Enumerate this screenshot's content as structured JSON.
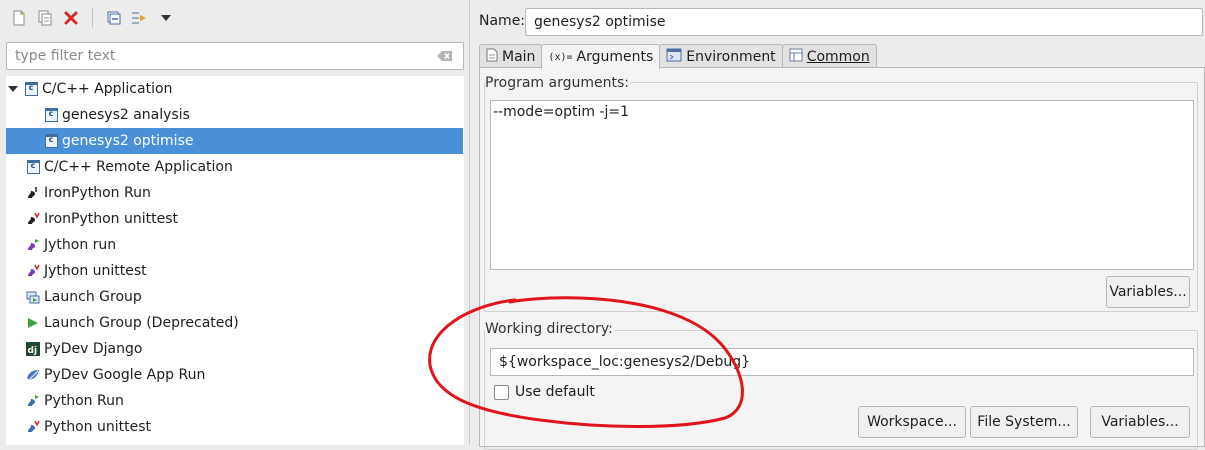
{
  "toolbar": {
    "icons": [
      "new-config-icon",
      "duplicate-icon",
      "delete-icon",
      "collapse-all-icon",
      "filter-icon",
      "view-menu-icon"
    ],
    "delete_color": "#d42a2a"
  },
  "filter": {
    "placeholder": "type filter text"
  },
  "tree": {
    "items": [
      {
        "label": "C/C++ Application",
        "icon": "cpp-app-icon",
        "expanded": true
      },
      {
        "label": "genesys2 analysis",
        "icon": "cpp-config-icon"
      },
      {
        "label": "genesys2 optimise",
        "icon": "cpp-config-icon",
        "selected": true
      },
      {
        "label": "C/C++ Remote Application",
        "icon": "cpp-app-icon"
      },
      {
        "label": "IronPython Run",
        "icon": "ironpython-run-icon"
      },
      {
        "label": "IronPython unittest",
        "icon": "ironpython-unittest-icon"
      },
      {
        "label": "Jython run",
        "icon": "jython-run-icon"
      },
      {
        "label": "Jython unittest",
        "icon": "jython-unittest-icon"
      },
      {
        "label": "Launch Group",
        "icon": "launch-group-icon"
      },
      {
        "label": "Launch Group (Deprecated)",
        "icon": "launch-group-deprecated-icon"
      },
      {
        "label": "PyDev Django",
        "icon": "django-icon"
      },
      {
        "label": "PyDev Google App Run",
        "icon": "google-app-icon"
      },
      {
        "label": "Python Run",
        "icon": "python-run-icon"
      },
      {
        "label": "Python unittest",
        "icon": "python-unittest-icon"
      }
    ],
    "selection_color": "#4a90d9"
  },
  "config": {
    "name_label": "Name:",
    "name_value": "genesys2 optimise",
    "tabs": [
      {
        "label": "Main",
        "icon": "main-tab-icon"
      },
      {
        "label": "Arguments",
        "icon": "arguments-tab-icon",
        "active": true
      },
      {
        "label": "Environment",
        "icon": "environment-tab-icon"
      },
      {
        "label": "Common",
        "icon": "common-tab-icon"
      }
    ],
    "program_args_label": "Program arguments:",
    "program_args_value": "--mode=optim -j=1",
    "variables_label": "Variables...",
    "working_dir_label": "Working directory:",
    "working_dir_value": "${workspace_loc:genesys2/Debug}",
    "use_default_label": "Use default",
    "use_default_checked": false,
    "workspace_label": "Workspace...",
    "filesystem_label": "File System...",
    "wd_variables_label": "Variables..."
  },
  "annotation": {
    "color": "#e0141c"
  }
}
